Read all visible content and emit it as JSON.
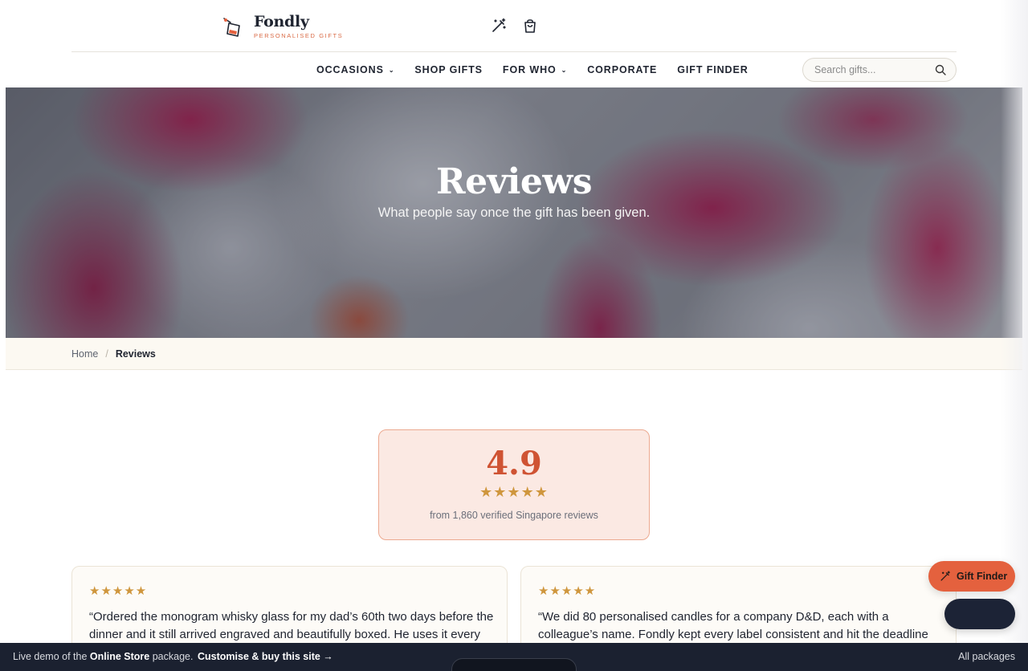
{
  "brand": {
    "name": "Fondly",
    "tagline": "PERSONALISED GIFTS"
  },
  "header_icons": [
    {
      "name": "magic-wand-icon"
    },
    {
      "name": "shopping-bag-icon"
    }
  ],
  "nav": {
    "items": [
      {
        "label": "OCCASIONS",
        "has_dropdown": true
      },
      {
        "label": "SHOP GIFTS",
        "has_dropdown": false
      },
      {
        "label": "FOR WHO",
        "has_dropdown": true
      },
      {
        "label": "CORPORATE",
        "has_dropdown": false
      },
      {
        "label": "GIFT FINDER",
        "has_dropdown": false
      }
    ],
    "search_placeholder": "Search gifts..."
  },
  "hero": {
    "title": "Reviews",
    "subtitle": "What people say once the gift has been given."
  },
  "breadcrumb": {
    "home": "Home",
    "separator": "/",
    "current": "Reviews"
  },
  "rating": {
    "score": "4.9",
    "stars": "★★★★★",
    "caption": "from 1,860 verified Singapore reviews"
  },
  "reviews": [
    {
      "stars": "★★★★★",
      "text": "“Ordered the monogram whisky glass for my dad’s 60th two days before the dinner and it still arrived engraved and beautifully boxed. He uses it every"
    },
    {
      "stars": "★★★★★",
      "text": "“We did 80 personalised candles for a company D&D, each with a colleague’s name. Fondly kept every label consistent and hit the deadline"
    }
  ],
  "floating": {
    "gift_finder_label": "Gift Finder"
  },
  "demo_bar": {
    "prefix": "Live demo of the ",
    "package": "Online Store",
    "suffix": " package.",
    "cta": "Customise & buy this site →",
    "all_packages": "All packages"
  },
  "colors": {
    "accent": "#e4613e",
    "rating_score": "#cf5333",
    "star": "#cf963d",
    "dark": "#1b2130"
  }
}
